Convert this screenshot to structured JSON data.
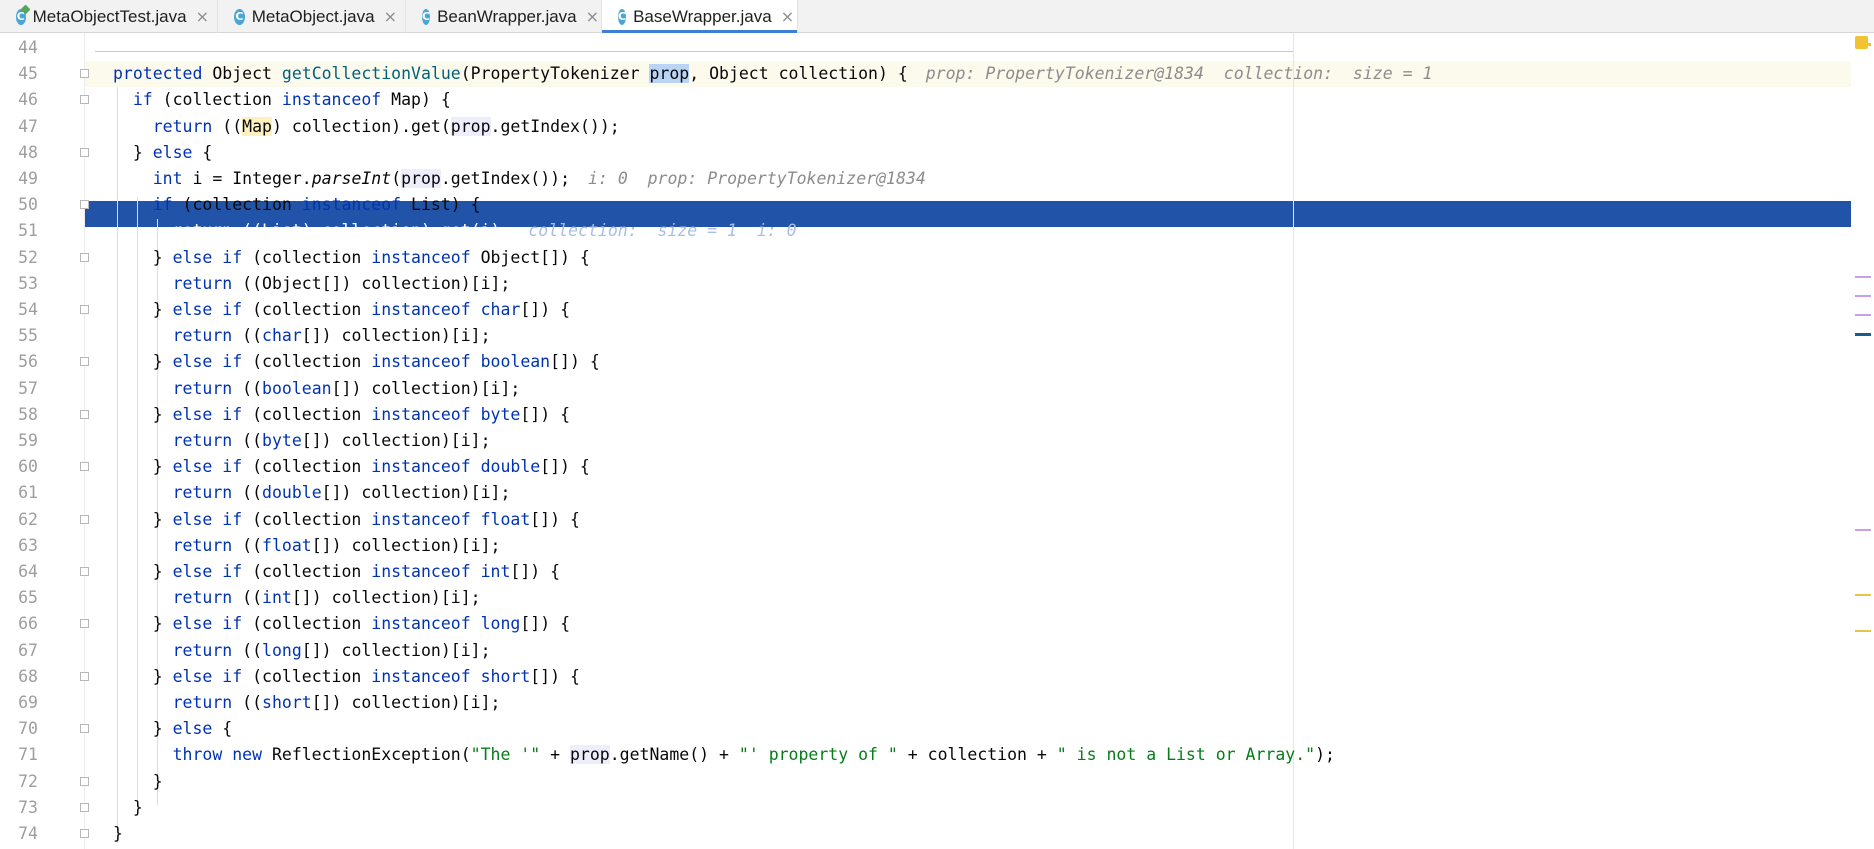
{
  "tabs": [
    {
      "label": "MetaObjectTest.java",
      "icon": "class-test-icon",
      "active": false
    },
    {
      "label": "MetaObject.java",
      "icon": "class-icon",
      "active": false
    },
    {
      "label": "BeanWrapper.java",
      "icon": "class-icon",
      "active": false
    },
    {
      "label": "BaseWrapper.java",
      "icon": "class-icon",
      "active": true
    }
  ],
  "tab_close_glyph": "×",
  "tab_icon_letter": "C",
  "lines": [
    {
      "n": "44",
      "html": ""
    },
    {
      "n": "45",
      "html": "<span class=\"kw\">protected</span> Object <span class=\"fn\">getCollectionValue</span>(PropertyTokenizer <span class=\"hlb\">prop</span>, Object collection) {",
      "hint": "prop: PropertyTokenizer@1834  collection:  size = 1"
    },
    {
      "n": "46",
      "html": "  <span class=\"kw\">if</span> (collection <span class=\"kw\">instanceof</span> Map) {"
    },
    {
      "n": "47",
      "html": "    <span class=\"kw\">return</span> ((<span class=\"hi\">Map</span>) collection).get(<span class=\"hlg\">prop</span>.getIndex());"
    },
    {
      "n": "48",
      "html": "  } <span class=\"kw\">else</span> {"
    },
    {
      "n": "49",
      "html": "    <span class=\"kw\">int</span> i = Integer.<span class=\"it\">parseInt</span>(<span class=\"hlg\">prop</span>.getIndex());",
      "hint": "i: 0  prop: PropertyTokenizer@1834"
    },
    {
      "n": "50",
      "html": "    <span class=\"kw\">if</span> (collection <span class=\"kw\">instanceof</span> List) {"
    },
    {
      "n": "51",
      "html": "      return ((List) collection).get(i);",
      "hint": "collection:  size = 1  i: 0",
      "selected": true
    },
    {
      "n": "52",
      "html": "    } <span class=\"kw\">else if</span> (collection <span class=\"kw\">instanceof</span> Object[]) {"
    },
    {
      "n": "53",
      "html": "      <span class=\"kw\">return</span> ((Object[]) collection)[i];"
    },
    {
      "n": "54",
      "html": "    } <span class=\"kw\">else if</span> (collection <span class=\"kw\">instanceof</span> <span class=\"kw\">char</span>[]) {"
    },
    {
      "n": "55",
      "html": "      <span class=\"kw\">return</span> ((<span class=\"kw\">char</span>[]) collection)[i];"
    },
    {
      "n": "56",
      "html": "    } <span class=\"kw\">else if</span> (collection <span class=\"kw\">instanceof</span> <span class=\"kw\">boolean</span>[]) {"
    },
    {
      "n": "57",
      "html": "      <span class=\"kw\">return</span> ((<span class=\"kw\">boolean</span>[]) collection)[i];"
    },
    {
      "n": "58",
      "html": "    } <span class=\"kw\">else if</span> (collection <span class=\"kw\">instanceof</span> <span class=\"kw\">byte</span>[]) {"
    },
    {
      "n": "59",
      "html": "      <span class=\"kw\">return</span> ((<span class=\"kw\">byte</span>[]) collection)[i];"
    },
    {
      "n": "60",
      "html": "    } <span class=\"kw\">else if</span> (collection <span class=\"kw\">instanceof</span> <span class=\"kw\">double</span>[]) {"
    },
    {
      "n": "61",
      "html": "      <span class=\"kw\">return</span> ((<span class=\"kw\">double</span>[]) collection)[i];"
    },
    {
      "n": "62",
      "html": "    } <span class=\"kw\">else if</span> (collection <span class=\"kw\">instanceof</span> <span class=\"kw\">float</span>[]) {"
    },
    {
      "n": "63",
      "html": "      <span class=\"kw\">return</span> ((<span class=\"kw\">float</span>[]) collection)[i];"
    },
    {
      "n": "64",
      "html": "    } <span class=\"kw\">else if</span> (collection <span class=\"kw\">instanceof</span> <span class=\"kw\">int</span>[]) {"
    },
    {
      "n": "65",
      "html": "      <span class=\"kw\">return</span> ((<span class=\"kw\">int</span>[]) collection)[i];"
    },
    {
      "n": "66",
      "html": "    } <span class=\"kw\">else if</span> (collection <span class=\"kw\">instanceof</span> <span class=\"kw\">long</span>[]) {"
    },
    {
      "n": "67",
      "html": "      <span class=\"kw\">return</span> ((<span class=\"kw\">long</span>[]) collection)[i];"
    },
    {
      "n": "68",
      "html": "    } <span class=\"kw\">else if</span> (collection <span class=\"kw\">instanceof</span> <span class=\"kw\">short</span>[]) {"
    },
    {
      "n": "69",
      "html": "      <span class=\"kw\">return</span> ((<span class=\"kw\">short</span>[]) collection)[i];"
    },
    {
      "n": "70",
      "html": "    } <span class=\"kw\">else</span> {"
    },
    {
      "n": "71",
      "html": "      <span class=\"kw\">throw new</span> ReflectionException(<span class=\"str\">\"The '\"</span> + <span class=\"hlg\">prop</span>.getName() + <span class=\"str\">\"' property of \"</span> + collection + <span class=\"str\">\" is not a List or Array.\"</span>);"
    },
    {
      "n": "72",
      "html": "    }"
    },
    {
      "n": "73",
      "html": "  }"
    },
    {
      "n": "74",
      "html": "}"
    }
  ],
  "folds": [
    "45",
    "46",
    "48",
    "50",
    "52",
    "54",
    "56",
    "58",
    "60",
    "62",
    "64",
    "66",
    "68",
    "70",
    "72",
    "73",
    "74"
  ],
  "colors": {
    "selection": "#2154a8",
    "keyword": "#0033b3",
    "method": "#00627a",
    "string": "#067d17",
    "caret_row": "#fcfaed"
  }
}
